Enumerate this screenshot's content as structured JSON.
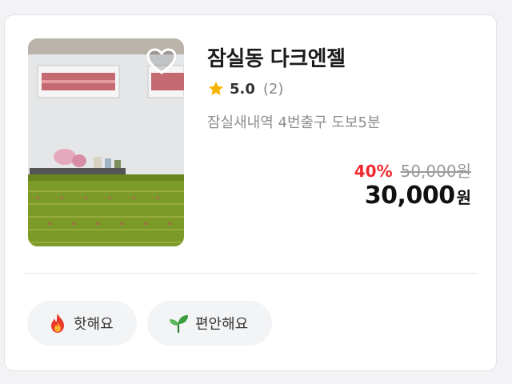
{
  "listing": {
    "title": "잠실동 다크엔젤",
    "rating": "5.0",
    "review_count": "(2)",
    "location": "잠실새내역 4번출구 도보5분",
    "discount": "40%",
    "original_price": "50,000원",
    "final_price": "30,000",
    "currency": "원",
    "favorited": false
  },
  "tags": [
    {
      "label": "핫해요",
      "icon": "fire-icon"
    },
    {
      "label": "편안해요",
      "icon": "sprout-icon"
    }
  ],
  "colors": {
    "accent_red": "#f0292e",
    "star": "#f7b500",
    "muted": "#8d8d92"
  },
  "icons": {
    "favorite": "heart-icon",
    "rating": "star-icon"
  }
}
